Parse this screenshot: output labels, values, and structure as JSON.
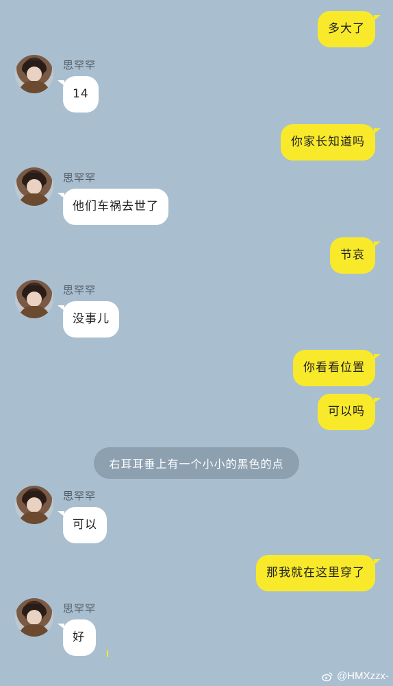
{
  "theme": {
    "background": "#a9bfd0",
    "right_bubble": "#f8ea2a",
    "left_bubble": "#ffffff",
    "system_bg": "#8da0b0"
  },
  "sender_name": "思罕罕",
  "messages": [
    {
      "side": "right",
      "text": "多大了"
    },
    {
      "side": "left",
      "text": "14"
    },
    {
      "side": "right",
      "text": "你家长知道吗"
    },
    {
      "side": "left",
      "text": "他们车祸去世了"
    },
    {
      "side": "right",
      "text": "节哀"
    },
    {
      "side": "left",
      "text": "没事儿"
    },
    {
      "side": "right",
      "text": "你看看位置"
    },
    {
      "side": "right",
      "text": "可以吗"
    },
    {
      "side": "left",
      "text": "可以"
    },
    {
      "side": "right",
      "text": "那我就在这里穿了"
    },
    {
      "side": "left",
      "text": "好"
    }
  ],
  "system_note": "右耳耳垂上有一个小小的黑色的点",
  "watermark": {
    "icon": "weibo-icon",
    "text": "@HMXzzx-"
  }
}
